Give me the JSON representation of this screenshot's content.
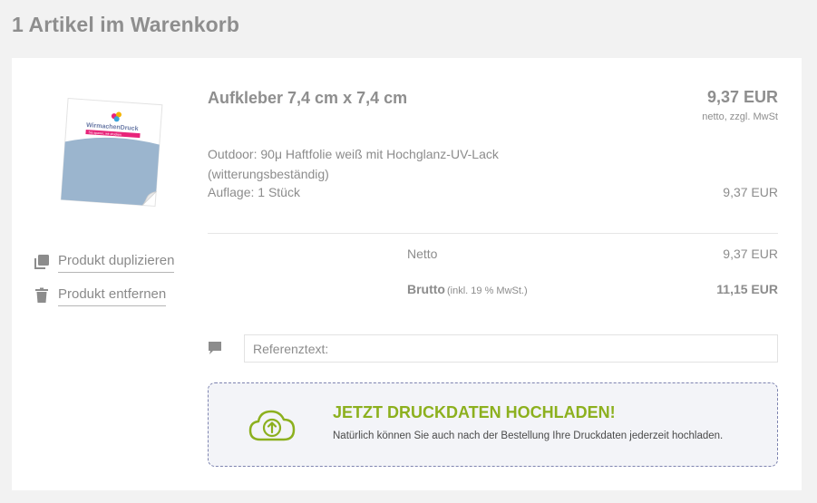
{
  "page": {
    "title": "1 Artikel im Warenkorb"
  },
  "product": {
    "image_brand": "WirmachenDruck",
    "image_tagline": "Sie sparen, wir drucken",
    "title": "Aufkleber 7,4 cm x 7,4 cm",
    "price": "9,37 EUR",
    "price_note": "netto, zzgl. MwSt",
    "description": "Outdoor: 90μ Haftfolie weiß mit Hochglanz-UV-Lack (witterungsbeständig)",
    "quantity": "Auflage: 1 Stück",
    "quantity_price": "9,37 EUR"
  },
  "actions": {
    "duplicate": "Produkt duplizieren",
    "remove": "Produkt entfernen"
  },
  "totals": {
    "netto_label": "Netto",
    "netto_value": "9,37 EUR",
    "brutto_label": "Brutto",
    "brutto_note": "(inkl. 19 % MwSt.)",
    "brutto_value": "11,15 EUR"
  },
  "reference": {
    "placeholder": "Referenztext:"
  },
  "upload": {
    "title": "JETZT DRUCKDATEN HOCHLADEN!",
    "subtitle": "Natürlich können Sie auch nach der Bestellung Ihre Druckdaten jederzeit hochladen."
  },
  "colors": {
    "accent_green": "#8cb01e",
    "upload_border": "#7e84b0",
    "sticker_blue": "#9bb5ce",
    "brand_pink": "#e8247a"
  },
  "icons": {
    "duplicate": "duplicate-icon",
    "remove": "trash-icon",
    "comment": "comment-icon",
    "upload": "cloud-upload-icon"
  }
}
